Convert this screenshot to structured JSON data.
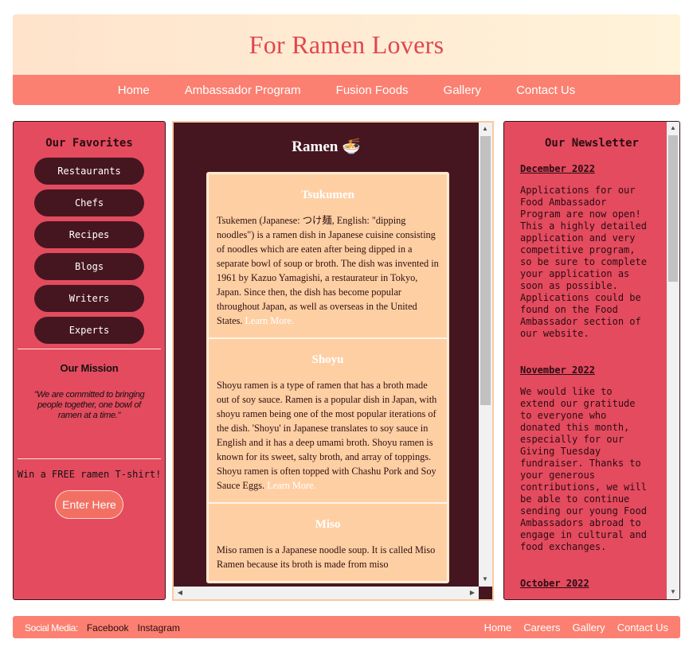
{
  "header": {
    "title": "For Ramen Lovers"
  },
  "topnav": [
    "Home",
    "Ambassador Program",
    "Fusion Foods",
    "Gallery",
    "Contact Us"
  ],
  "left": {
    "favorites_title": "Our Favorites",
    "favorites": [
      "Restaurants",
      "Chefs",
      "Recipes",
      "Blogs",
      "Writers",
      "Experts"
    ],
    "mission_title": "Our Mission",
    "mission_text": "\"We are committed to bringing people together, one bowl of ramen at a time.\"",
    "promo": "Win a FREE ramen T-shirt!",
    "enter_button": "Enter Here"
  },
  "main": {
    "title": "Ramen 🍜",
    "cards": [
      {
        "title": "Tsukumen",
        "text": "Tsukemen (Japanese: つけ麺, English: \"dipping noodles\") is a ramen dish in Japanese cuisine consisting of noodles which are eaten after being dipped in a separate bowl of soup or broth. The dish was invented in 1961 by Kazuo Yamagishi, a restaurateur in Tokyo, Japan. Since then, the dish has become popular throughout Japan, as well as overseas in the United States.",
        "link": "Learn More."
      },
      {
        "title": "Shoyu",
        "text": "Shoyu ramen is a type of ramen that has a broth made out of soy sauce. Ramen is a popular dish in Japan, with shoyu ramen being one of the most popular iterations of the dish. 'Shoyu' in Japanese translates to soy sauce in English and it has a deep umami broth. Shoyu ramen is known for its sweet, salty broth, and array of toppings. Shoyu ramen is often topped with Chashu Pork and Soy Sauce Eggs.",
        "link": "Learn More."
      },
      {
        "title": "Miso",
        "text": "Miso ramen is a Japanese noodle soup. It is called Miso Ramen because its broth is made from miso",
        "link": ""
      }
    ]
  },
  "right": {
    "newsletter_title": "Our Newsletter",
    "items": [
      {
        "date": "December 2022",
        "text": "Applications for our Food Ambassador Program are now open! This a highly detailed application and very competitive program, so be sure to complete your application as soon as possible. Applications could be found on the Food Ambassador section of our website."
      },
      {
        "date": "November 2022",
        "text": "We would like to extend our gratitude to everyone who donated this month, especially for our Giving Tuesday fundraiser. Thanks to your generous contributions, we will be able to continue sending our young Food Ambassadors abroad to engage in cultural and food exchanges."
      },
      {
        "date": "October 2022",
        "text": ""
      }
    ]
  },
  "footer": {
    "social_label": "Social Media:",
    "social_links": [
      "Facebook",
      "Instagram"
    ],
    "nav": [
      "Home",
      "Careers",
      "Gallery",
      "Contact Us"
    ]
  }
}
